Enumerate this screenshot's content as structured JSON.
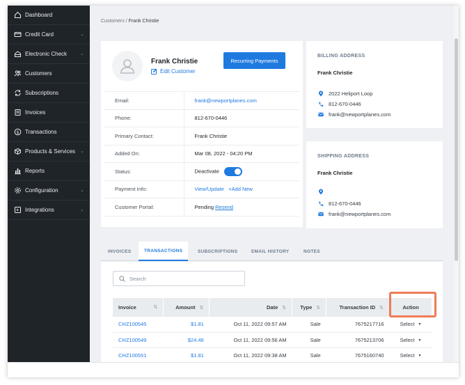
{
  "sidebar": {
    "items": [
      {
        "label": "Dashboard",
        "icon": "home-icon",
        "has_submenu": false
      },
      {
        "label": "Credit Card",
        "icon": "credit-card-icon",
        "has_submenu": true
      },
      {
        "label": "Electronic Check",
        "icon": "bank-icon",
        "has_submenu": true
      },
      {
        "label": "Customers",
        "icon": "users-icon",
        "has_submenu": false
      },
      {
        "label": "Subscriptions",
        "icon": "refresh-icon",
        "has_submenu": false
      },
      {
        "label": "Invoices",
        "icon": "invoice-icon",
        "has_submenu": false
      },
      {
        "label": "Transactions",
        "icon": "dollar-circle-icon",
        "has_submenu": false
      },
      {
        "label": "Products & Services",
        "icon": "box-icon",
        "has_submenu": true
      },
      {
        "label": "Reports",
        "icon": "bar-chart-icon",
        "has_submenu": false
      },
      {
        "label": "Configuration",
        "icon": "gear-icon",
        "has_submenu": true
      },
      {
        "label": "Integrations",
        "icon": "plug-icon",
        "has_submenu": true
      }
    ]
  },
  "breadcrumb": {
    "parent": "Customers",
    "separator": " / ",
    "current": "Frank Christie"
  },
  "customer": {
    "name": "Frank Christie",
    "edit_label": "Edit Customer",
    "recurring_button": "Recurring Payments",
    "info": {
      "email_label": "Email:",
      "email": "frank@newportplanes.com",
      "phone_label": "Phone:",
      "phone": "812-670-0446",
      "primary_label": "Primary Contact:",
      "primary": "Frank Christie",
      "added_label": "Added On:",
      "added": "Mar 08, 2022 - 04:20 PM",
      "status_label": "Status:",
      "status": "Deactivate",
      "payment_label": "Payment Info:",
      "payment_view": "View/Update",
      "payment_add": "+Add New",
      "portal_label": "Customer Portal:",
      "portal_status": "Pending",
      "portal_resend": "Resend"
    }
  },
  "billing": {
    "title": "BILLING ADDRESS",
    "name": "Frank Christie",
    "address": "2022 Heliport Loop",
    "phone": "812-670-0446",
    "email": "frank@newportplanes.com"
  },
  "shipping": {
    "title": "SHIPPING ADDRESS",
    "name": "Frank Christie",
    "address": "",
    "phone": "812-670-0446",
    "email": "frank@newportplanes.com"
  },
  "tabs": [
    "INVOICES",
    "TRANSACTIONS",
    "SUBSCRIPTIONS",
    "EMAIL HISTORY",
    "NOTES"
  ],
  "active_tab": "TRANSACTIONS",
  "search": {
    "placeholder": "Search"
  },
  "table": {
    "headers": {
      "invoice": "Invoice",
      "amount": "Amount",
      "date": "Date",
      "type": "Type",
      "txid": "Transaction ID",
      "action": "Action"
    },
    "rows": [
      {
        "invoice": "CHZ100545",
        "amount": "$1.81",
        "date": "Oct 11, 2022 09:57 AM",
        "type": "Sale",
        "txid": "7675217716",
        "action": "Select"
      },
      {
        "invoice": "CHZ100549",
        "amount": "$24.46",
        "date": "Oct 11, 2022 09:56 AM",
        "type": "Sale",
        "txid": "7675213706",
        "action": "Select"
      },
      {
        "invoice": "CHZ100551",
        "amount": "$1.81",
        "date": "Oct 11, 2022 09:38 AM",
        "type": "Sale",
        "txid": "7675160740",
        "action": "Select"
      }
    ]
  },
  "colors": {
    "sidebar_bg": "#1f2429",
    "accent": "#1f7ae0",
    "highlight": "#ef7a58",
    "page_bg": "#eef0f4"
  }
}
